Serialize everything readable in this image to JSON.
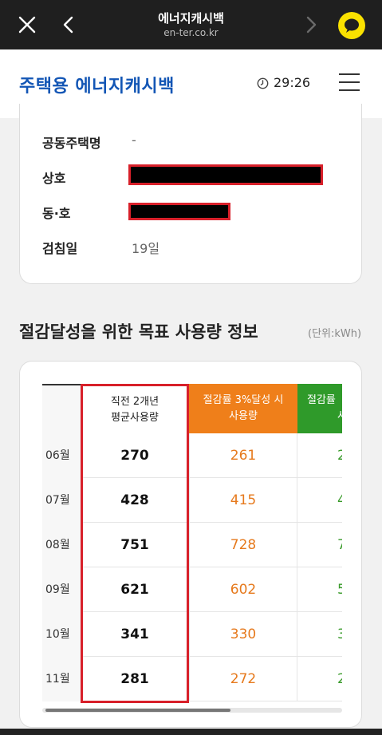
{
  "browser": {
    "title": "에너지캐시백",
    "url": "en-ter.co.kr"
  },
  "header": {
    "brand": "주택용 에너지캐시백",
    "timer": "29:26"
  },
  "info": [
    {
      "label": "공동주택명",
      "value": "-"
    },
    {
      "label": "상호",
      "value": ""
    },
    {
      "label": "동·호",
      "value": ""
    },
    {
      "label": "검침일",
      "value": "19일"
    }
  ],
  "section": {
    "title": "절감달성을 위한 목표 사용량 정보",
    "unit": "(단위:kWh)"
  },
  "table": {
    "headers": {
      "avg_line1": "직전 2개년",
      "avg_line2": "평균사용량",
      "three_line1": "절감률 3%달성 시",
      "three_line2": "사용량",
      "five_line1": "절감률",
      "five_line2": "사"
    },
    "rows": [
      {
        "month": "06월",
        "avg": "270",
        "three": "261",
        "five": "2"
      },
      {
        "month": "07월",
        "avg": "428",
        "three": "415",
        "five": "4"
      },
      {
        "month": "08월",
        "avg": "751",
        "three": "728",
        "five": "7"
      },
      {
        "month": "09월",
        "avg": "621",
        "three": "602",
        "five": "5"
      },
      {
        "month": "10월",
        "avg": "341",
        "three": "330",
        "five": "3"
      },
      {
        "month": "11월",
        "avg": "281",
        "three": "272",
        "five": "2"
      }
    ]
  },
  "colors": {
    "brand": "#1356b5",
    "three_header": "#ef7f1a",
    "five_header": "#2f9a2a",
    "highlight": "#d8202a"
  }
}
